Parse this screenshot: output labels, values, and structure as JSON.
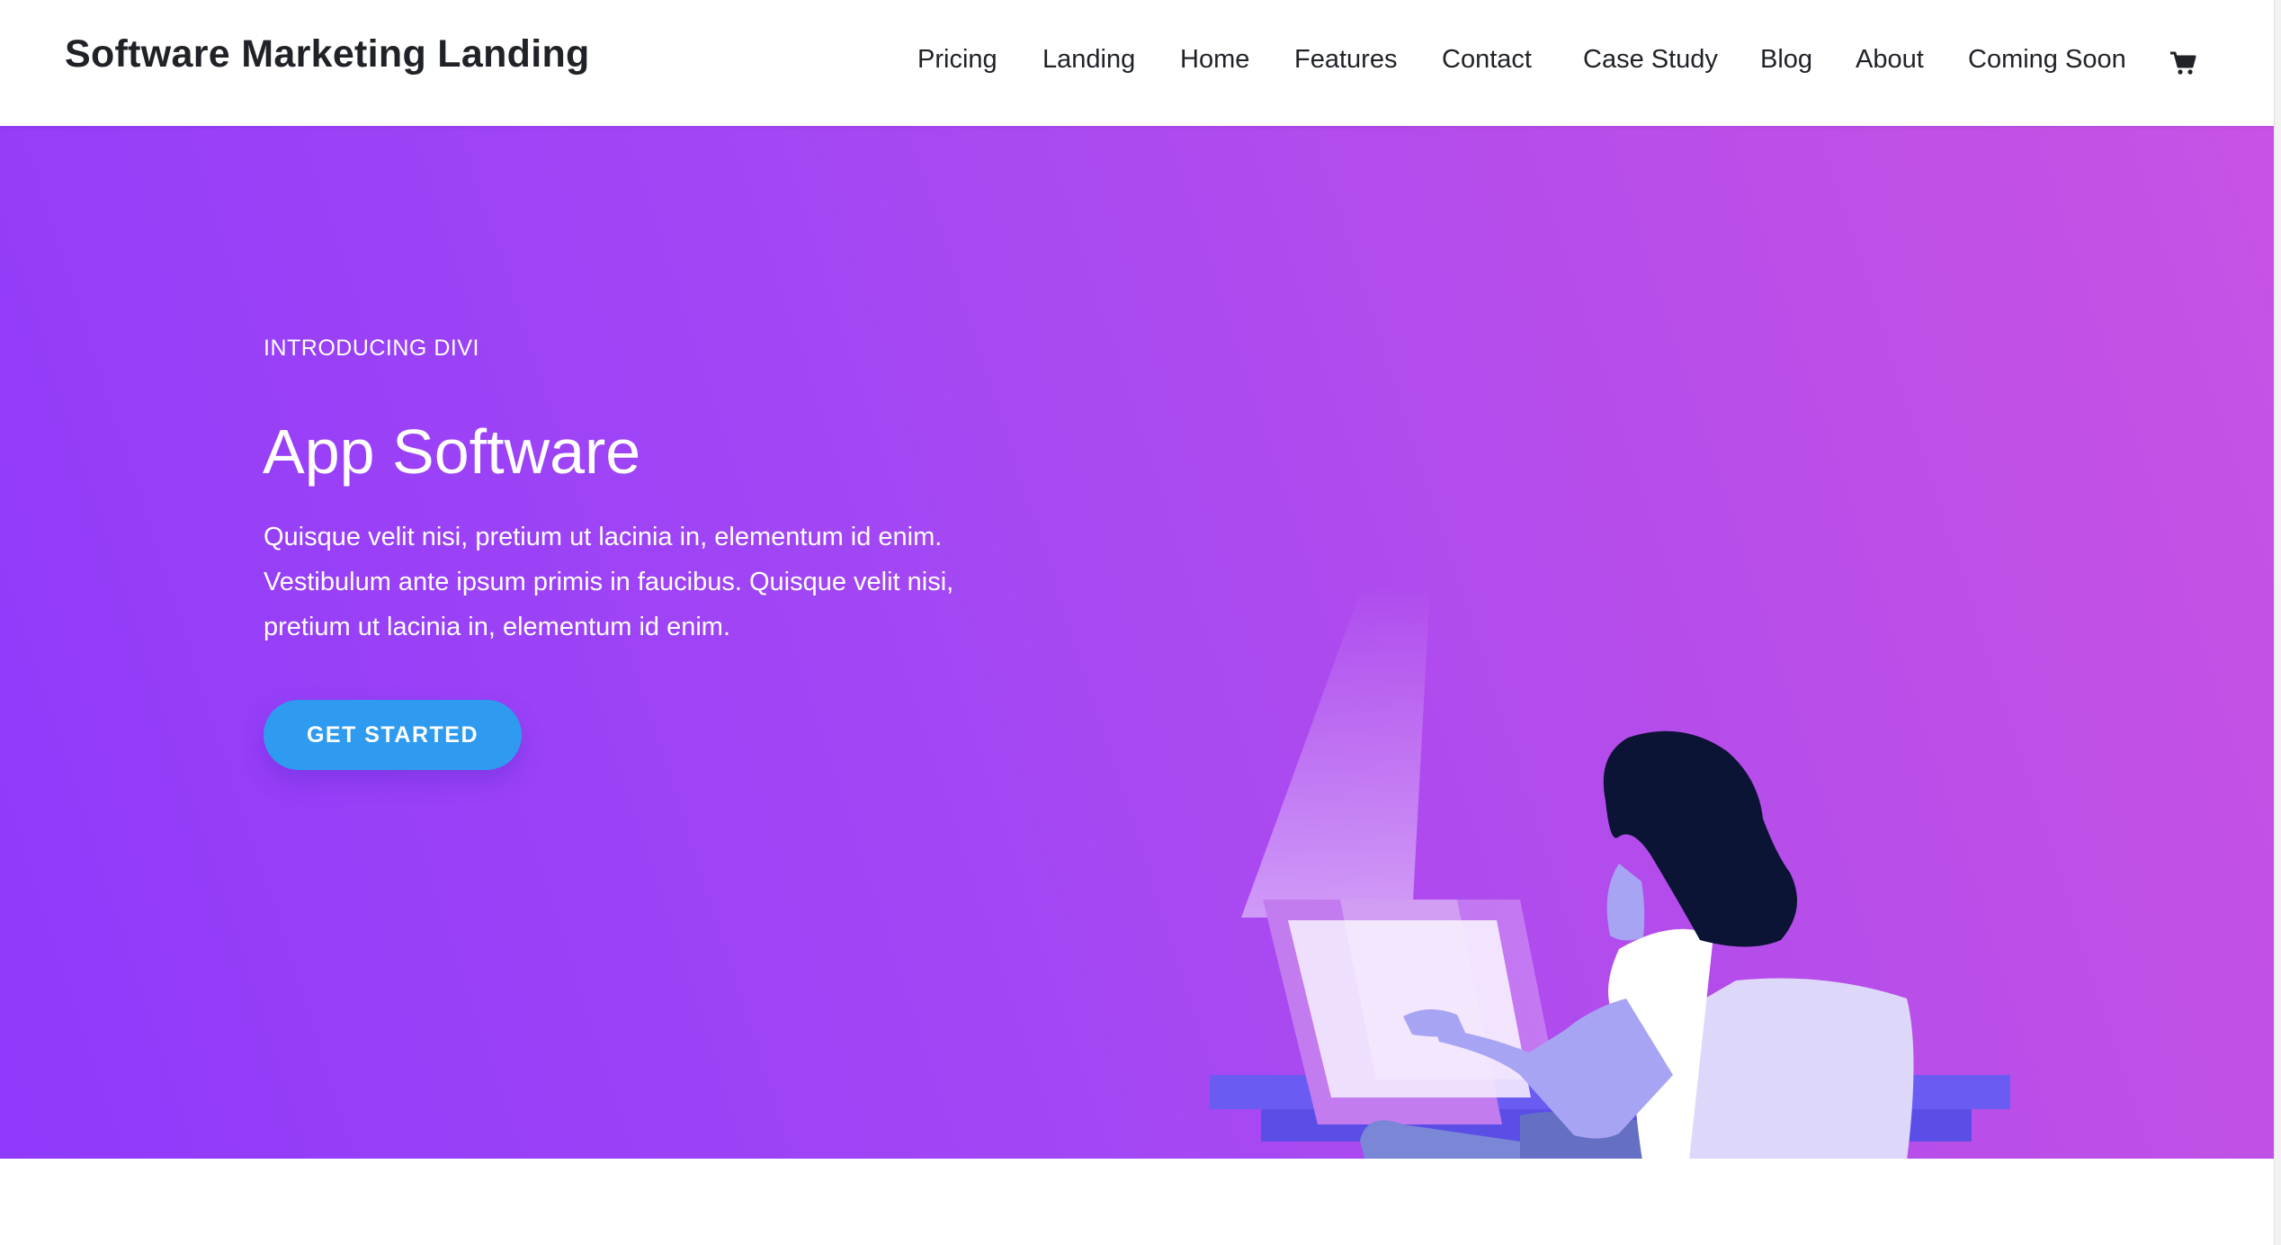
{
  "header": {
    "site_title": "Software Marketing Landing",
    "nav": [
      {
        "label": "Pricing"
      },
      {
        "label": "Landing"
      },
      {
        "label": "Home"
      },
      {
        "label": "Features"
      },
      {
        "label": "Contact"
      },
      {
        "label": "Case Study"
      },
      {
        "label": "Blog"
      },
      {
        "label": "About"
      },
      {
        "label": "Coming Soon"
      }
    ],
    "cart_icon": "shopping-cart-icon"
  },
  "hero": {
    "eyebrow": "INTRODUCING DIVI",
    "headline": "App Software",
    "body": "Quisque velit nisi, pretium ut lacinia in, elementum id enim. Vestibulum ante ipsum primis in faucibus. Quisque velit nisi, pretium ut lacinia in, elementum id enim.",
    "cta_label": "GET STARTED",
    "illustration": "woman-at-laptop-illustration"
  },
  "colors": {
    "hero_gradient_start": "#8f39fb",
    "hero_gradient_end": "#c852e5",
    "cta_background": "#2e9bf0",
    "text_dark": "#1f2227",
    "text_light": "#ffffff"
  }
}
